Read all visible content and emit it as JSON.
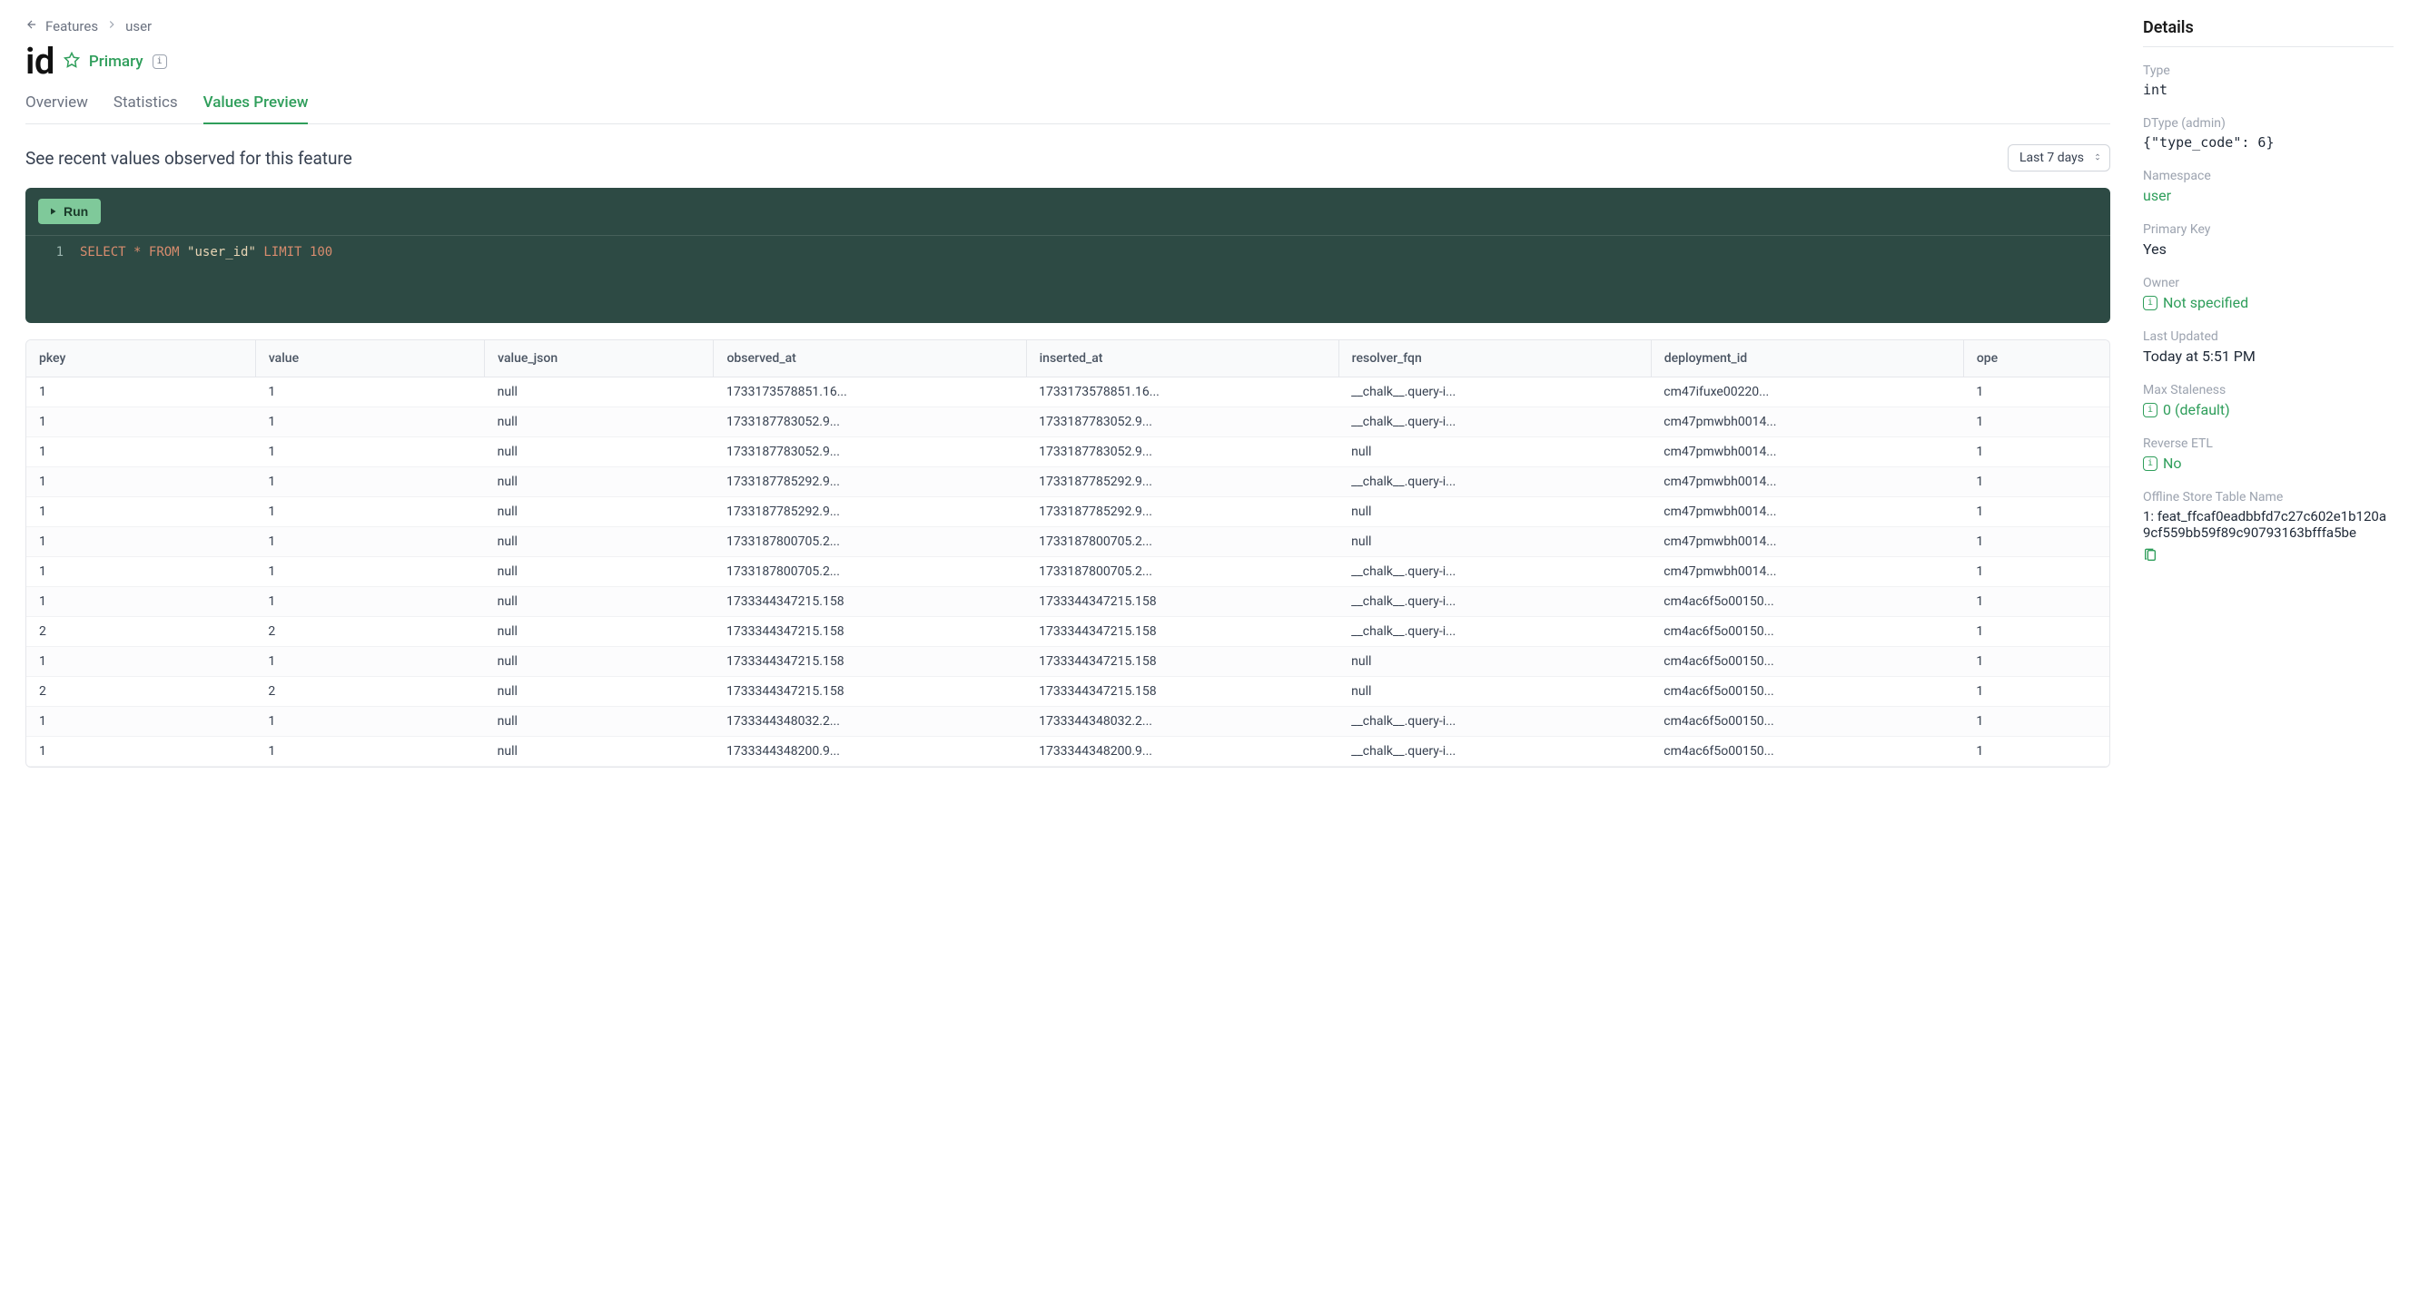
{
  "breadcrumb": {
    "root": "Features",
    "current": "user"
  },
  "header": {
    "title": "id",
    "primary_label": "Primary"
  },
  "tabs": [
    {
      "label": "Overview",
      "active": false
    },
    {
      "label": "Statistics",
      "active": false
    },
    {
      "label": "Values Preview",
      "active": true
    }
  ],
  "subheader": "See recent values observed for this feature",
  "range": {
    "selected": "Last 7 days"
  },
  "query": {
    "run_label": "Run",
    "line_no": "1",
    "sql": {
      "select": "SELECT",
      "star": "*",
      "from": "FROM",
      "table": "\"user_id\"",
      "limit": "LIMIT",
      "limit_n": "100"
    }
  },
  "table": {
    "columns": [
      "pkey",
      "value",
      "value_json",
      "observed_at",
      "inserted_at",
      "resolver_fqn",
      "deployment_id",
      "ope"
    ],
    "rows": [
      [
        "1",
        "1",
        "null",
        "1733173578851.16...",
        "1733173578851.16...",
        "__chalk__.query-i...",
        "cm47ifuxe00220...",
        "1"
      ],
      [
        "1",
        "1",
        "null",
        "1733187783052.9...",
        "1733187783052.9...",
        "__chalk__.query-i...",
        "cm47pmwbh0014...",
        "1"
      ],
      [
        "1",
        "1",
        "null",
        "1733187783052.9...",
        "1733187783052.9...",
        "null",
        "cm47pmwbh0014...",
        "1"
      ],
      [
        "1",
        "1",
        "null",
        "1733187785292.9...",
        "1733187785292.9...",
        "__chalk__.query-i...",
        "cm47pmwbh0014...",
        "1"
      ],
      [
        "1",
        "1",
        "null",
        "1733187785292.9...",
        "1733187785292.9...",
        "null",
        "cm47pmwbh0014...",
        "1"
      ],
      [
        "1",
        "1",
        "null",
        "1733187800705.2...",
        "1733187800705.2...",
        "null",
        "cm47pmwbh0014...",
        "1"
      ],
      [
        "1",
        "1",
        "null",
        "1733187800705.2...",
        "1733187800705.2...",
        "__chalk__.query-i...",
        "cm47pmwbh0014...",
        "1"
      ],
      [
        "1",
        "1",
        "null",
        "1733344347215.158",
        "1733344347215.158",
        "__chalk__.query-i...",
        "cm4ac6f5o00150...",
        "1"
      ],
      [
        "2",
        "2",
        "null",
        "1733344347215.158",
        "1733344347215.158",
        "__chalk__.query-i...",
        "cm4ac6f5o00150...",
        "1"
      ],
      [
        "1",
        "1",
        "null",
        "1733344347215.158",
        "1733344347215.158",
        "null",
        "cm4ac6f5o00150...",
        "1"
      ],
      [
        "2",
        "2",
        "null",
        "1733344347215.158",
        "1733344347215.158",
        "null",
        "cm4ac6f5o00150...",
        "1"
      ],
      [
        "1",
        "1",
        "null",
        "1733344348032.2...",
        "1733344348032.2...",
        "__chalk__.query-i...",
        "cm4ac6f5o00150...",
        "1"
      ],
      [
        "1",
        "1",
        "null",
        "1733344348200.9...",
        "1733344348200.9...",
        "__chalk__.query-i...",
        "cm4ac6f5o00150...",
        "1"
      ]
    ]
  },
  "details": {
    "title": "Details",
    "type": {
      "label": "Type",
      "value": "int"
    },
    "dtype": {
      "label": "DType (admin)",
      "value": "{\"type_code\": 6}"
    },
    "namespace": {
      "label": "Namespace",
      "value": "user"
    },
    "pkey": {
      "label": "Primary Key",
      "value": "Yes"
    },
    "owner": {
      "label": "Owner",
      "value": "Not specified"
    },
    "updated": {
      "label": "Last Updated",
      "value": "Today at 5:51 PM"
    },
    "staleness": {
      "label": "Max Staleness",
      "value": "0 (default)"
    },
    "retl": {
      "label": "Reverse ETL",
      "value": "No"
    },
    "offline": {
      "label": "Offline Store Table Name",
      "value": "1: feat_ffcaf0eadbbfd7c27c602e1b120a9cf559bb59f89c90793163bfffa5be"
    }
  }
}
